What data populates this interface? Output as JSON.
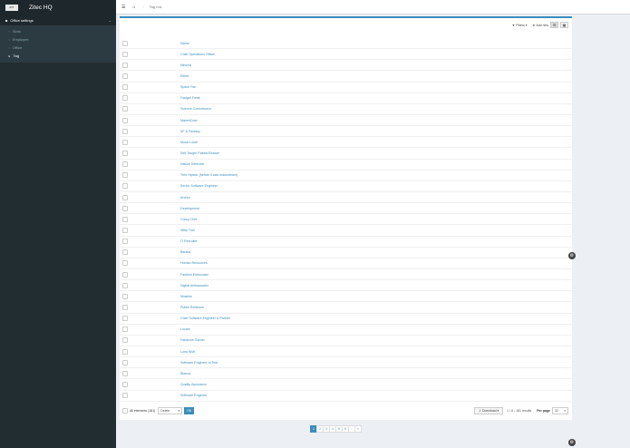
{
  "sidebar": {
    "brand_logo": "ZIT",
    "brand_name": "Zitec HQ",
    "menu_header": "Office settings",
    "items": [
      {
        "label": "Slots"
      },
      {
        "label": "Employee"
      },
      {
        "label": "Office"
      },
      {
        "label": "Tag"
      }
    ]
  },
  "topbar": {
    "breadcrumb_current": "Tag List"
  },
  "toolbar": {
    "filters": "Filters",
    "add_new": "Add new"
  },
  "table": {
    "header": "Name",
    "rows": [
      "Chief Operations Officer",
      "Ninsma",
      "Elbert",
      "Space Fan",
      "Gadget Freak",
      "Science Connoisseur",
      "Maker/Doer",
      "SF & Fantasy",
      "Music Lover",
      "Self-Taught Painter/Drawer",
      "Nature Defender",
      "Tree Hipster (before it was mainstream)",
      "Senior Software Engineer",
      "Archivi",
      "Development",
      "Crazy Chef",
      "Witty Troll",
      "IT Recruiter",
      "Barista",
      "Human Resources",
      "Fashion Enthusiast",
      "Digital Ambassador",
      "Mirabila",
      "Public Relations",
      "Chief Software Engineer & Partner",
      "Lucian",
      "Hardcore Gamer",
      "Luna Wolf",
      "Software Engineer In Test",
      "Bianca",
      "Quality Assurance",
      "Software Engineer"
    ]
  },
  "footer": {
    "all_elements": "All elements (181)",
    "action": "Delete",
    "ok": "OK",
    "download": "Download",
    "results": "1 / 6 - 181 results",
    "per_page_label": "Per page",
    "per_page_value": "32"
  },
  "pagination": {
    "pages": [
      "1",
      "2",
      "3",
      "4",
      "5",
      "6"
    ],
    "next": "›",
    "last": "»"
  }
}
